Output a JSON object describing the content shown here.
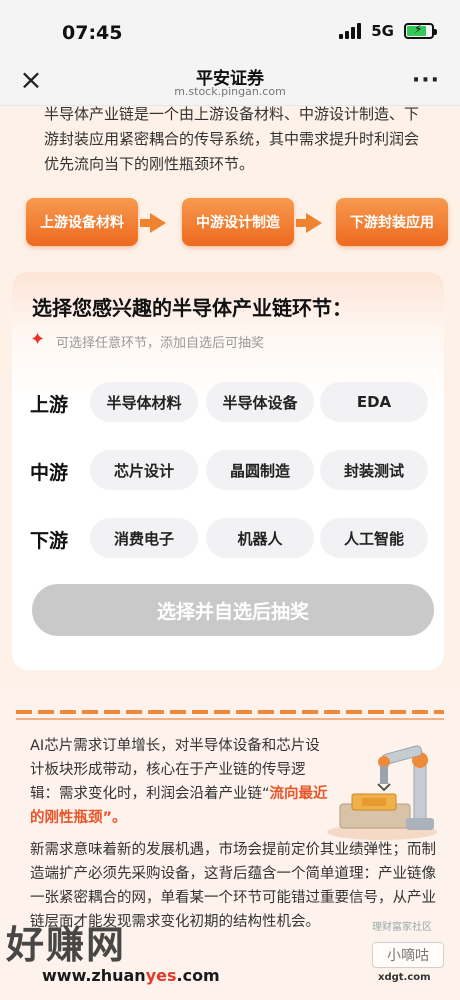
{
  "status": {
    "time": "07:45",
    "network": "5G"
  },
  "nav": {
    "close_icon": "close-icon",
    "title": "平安证券",
    "subtitle": "m.stock.pingan.com",
    "more_icon": "more-dots-icon"
  },
  "intro": {
    "text": "半导体产业链是一个由上游设备材料、中游设计制造、下游封装应用紧密耦合的传导系统，其中需求提升时利润会优先流向当下的刚性瓶颈环节。"
  },
  "flow": {
    "steps": [
      "上游设备材料",
      "中游设计制造",
      "下游封装应用"
    ]
  },
  "card": {
    "title": "选择您感兴趣的半导体产业链环节：",
    "hint": "可选择任意环节，添加自选后可抽奖",
    "rows": [
      {
        "label": "上游",
        "chips": [
          "半导体材料",
          "半导体设备",
          "EDA"
        ]
      },
      {
        "label": "中游",
        "chips": [
          "芯片设计",
          "晶圆制造",
          "封装测试"
        ]
      },
      {
        "label": "下游",
        "chips": [
          "消费电子",
          "机器人",
          "人工智能"
        ]
      }
    ],
    "submit": "选择并自选后抽奖"
  },
  "article": {
    "p1_a": "AI芯片需求订单增长，对半导体设备和芯片设计板块形成带动，核心在于产业链的传导逻辑：需求变化时，利润会沿着产业链“",
    "p1_hl": "流向最近的刚性瓶颈",
    "p1_b": "”。",
    "p2": "新需求意味着新的发展机遇，市场会提前定价其业绩弹性；而制造端扩产必须先采购设备，这背后蕴含一个简单道理：产业链像一张紧密耦合的网，单看某一个环节可能错过重要信号，从产业链层面才能发现需求变化初期的结构性机会。"
  },
  "watermarks": {
    "big": "好赚网",
    "url_a": "www.zhuan",
    "url_red": "yes",
    "url_b": ".com",
    "small": "小嘀咕",
    "small_url": "xdgt.com",
    "corner": "理财富家社区"
  },
  "colors": {
    "accent": "#ee6a1f",
    "highlight": "#e8552a",
    "disabled_button": "#c9c9c9"
  }
}
